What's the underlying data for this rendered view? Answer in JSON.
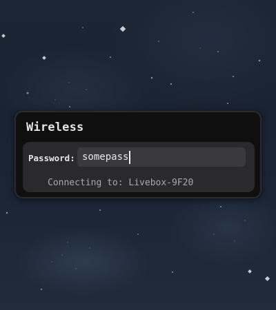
{
  "dialog": {
    "title": "Wireless",
    "password_label": "Password:",
    "password_value": "somepass",
    "status_text": "Connecting to: Livebox-9F20"
  },
  "colors": {
    "dialog_background": "#0f0f10",
    "panel_background": "#2a2a2c",
    "input_background": "#3a3a3d",
    "wallpaper": "#1b2533"
  }
}
